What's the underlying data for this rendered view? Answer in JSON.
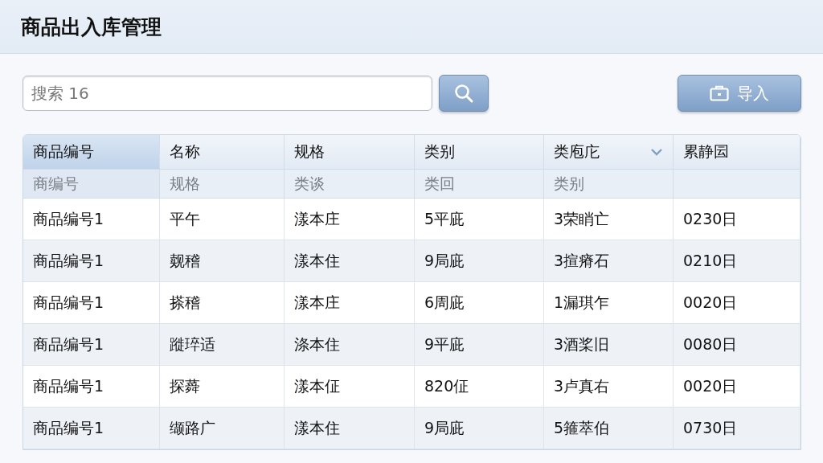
{
  "title": "商品出入库管理",
  "search": {
    "placeholder": "搜索 16"
  },
  "import_button": {
    "label": "导入"
  },
  "table": {
    "columns": [
      {
        "label": "商品编号",
        "selected": true,
        "dropdown": false,
        "filter": "商编号"
      },
      {
        "label": "名称",
        "selected": false,
        "dropdown": false,
        "filter": "规格"
      },
      {
        "label": "规格",
        "selected": false,
        "dropdown": false,
        "filter": "类谈"
      },
      {
        "label": "类别",
        "selected": false,
        "dropdown": false,
        "filter": "类回"
      },
      {
        "label": "类庖庀",
        "selected": false,
        "dropdown": true,
        "filter": "类别"
      },
      {
        "label": "累静囩",
        "selected": false,
        "dropdown": false
      }
    ],
    "rows": [
      [
        "商品编号1",
        "平午",
        "漾本庄",
        "5平庛",
        "3荣睄亡",
        "0230日"
      ],
      [
        "商品编号1",
        "觌稽",
        "漾本住",
        "9局庛",
        "3揎瘠石",
        "0210日"
      ],
      [
        "商品编号1",
        "搽稽",
        "漾本庄",
        "6周庛",
        "1漏琪乍",
        "0020日"
      ],
      [
        "商品编号1",
        "蹝琗适",
        "涤本住",
        "9平庛",
        "3酒桨旧",
        "0080日"
      ],
      [
        "商品编号1",
        "探蕣",
        "漾本佂",
        "820佂",
        "3卢真右",
        "0020日"
      ],
      [
        "商品编号1",
        "缬路广",
        "漾本住",
        "9局庛",
        "5箍萃伯",
        "0730日"
      ]
    ]
  }
}
